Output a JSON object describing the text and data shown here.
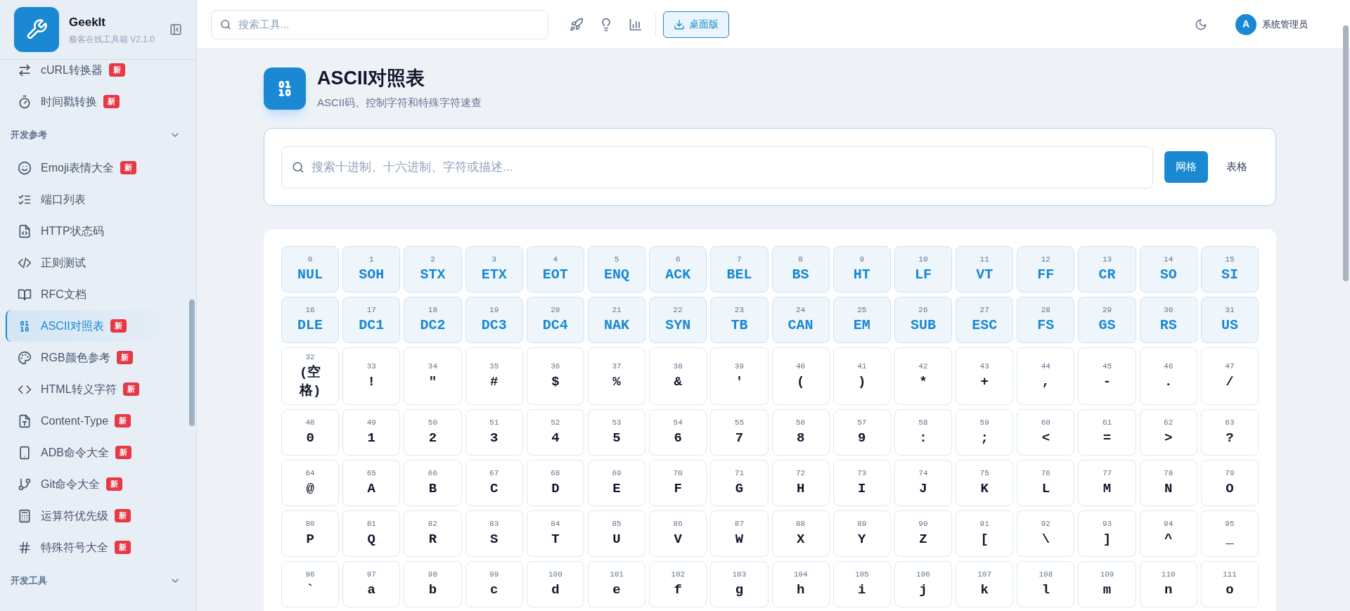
{
  "sidebar": {
    "brand": {
      "name": "GeekIt",
      "subtitle": "极客在线工具箱 V2.1.0"
    },
    "entries": [
      {
        "kind": "item",
        "label": "cURL转换器",
        "badge": "新",
        "selected": false
      },
      {
        "kind": "item",
        "label": "时间戳转换",
        "badge": "新",
        "selected": false
      },
      {
        "kind": "section",
        "label": "开发参考",
        "expanded": true
      },
      {
        "kind": "item",
        "label": "Emoji表情大全",
        "badge": "新",
        "selected": false
      },
      {
        "kind": "item",
        "label": "端口列表",
        "selected": false
      },
      {
        "kind": "item",
        "label": "HTTP状态码",
        "selected": false
      },
      {
        "kind": "item",
        "label": "正则测试",
        "selected": false
      },
      {
        "kind": "item",
        "label": "RFC文档",
        "selected": false
      },
      {
        "kind": "item",
        "label": "ASCII对照表",
        "badge": "新",
        "selected": true
      },
      {
        "kind": "item",
        "label": "RGB颜色参考",
        "badge": "新",
        "selected": false
      },
      {
        "kind": "item",
        "label": "HTML转义字符",
        "badge": "新",
        "selected": false
      },
      {
        "kind": "item",
        "label": "Content-Type",
        "badge": "新",
        "selected": false
      },
      {
        "kind": "item",
        "label": "ADB命令大全",
        "badge": "新",
        "selected": false
      },
      {
        "kind": "item",
        "label": "Git命令大全",
        "badge": "新",
        "selected": false
      },
      {
        "kind": "item",
        "label": "运算符优先级",
        "badge": "新",
        "selected": false
      },
      {
        "kind": "item",
        "label": "特殊符号大全",
        "badge": "新",
        "selected": false
      },
      {
        "kind": "section",
        "label": "开发工具",
        "expanded": true
      }
    ]
  },
  "header": {
    "search": {
      "placeholder": "搜索工具..."
    },
    "desktop_button": "桌面版",
    "user": {
      "avatar": "A",
      "name": "系统管理员"
    }
  },
  "page": {
    "title": "ASCII对照表",
    "subtitle": "ASCII码、控制字符和特殊字符速查"
  },
  "filter": {
    "search": {
      "placeholder": "搜索十进制、十六进制、字符或描述..."
    },
    "views": [
      {
        "label": "网格",
        "selected": true
      },
      {
        "label": "表格",
        "selected": false
      }
    ]
  },
  "cells": [
    {
      "code": "0",
      "char": "NUL",
      "kind": "control"
    },
    {
      "code": "1",
      "char": "SOH",
      "kind": "control"
    },
    {
      "code": "2",
      "char": "STX",
      "kind": "control"
    },
    {
      "code": "3",
      "char": "ETX",
      "kind": "control"
    },
    {
      "code": "4",
      "char": "EOT",
      "kind": "control"
    },
    {
      "code": "5",
      "char": "ENQ",
      "kind": "control"
    },
    {
      "code": "6",
      "char": "ACK",
      "kind": "control"
    },
    {
      "code": "7",
      "char": "BEL",
      "kind": "control"
    },
    {
      "code": "8",
      "char": "BS",
      "kind": "control"
    },
    {
      "code": "9",
      "char": "HT",
      "kind": "control"
    },
    {
      "code": "10",
      "char": "LF",
      "kind": "control"
    },
    {
      "code": "11",
      "char": "VT",
      "kind": "control"
    },
    {
      "code": "12",
      "char": "FF",
      "kind": "control"
    },
    {
      "code": "13",
      "char": "CR",
      "kind": "control"
    },
    {
      "code": "14",
      "char": "SO",
      "kind": "control"
    },
    {
      "code": "15",
      "char": "SI",
      "kind": "control"
    },
    {
      "code": "16",
      "char": "DLE",
      "kind": "control"
    },
    {
      "code": "17",
      "char": "DC1",
      "kind": "control"
    },
    {
      "code": "18",
      "char": "DC2",
      "kind": "control"
    },
    {
      "code": "19",
      "char": "DC3",
      "kind": "control"
    },
    {
      "code": "20",
      "char": "DC4",
      "kind": "control"
    },
    {
      "code": "21",
      "char": "NAK",
      "kind": "control"
    },
    {
      "code": "22",
      "char": "SYN",
      "kind": "control"
    },
    {
      "code": "23",
      "char": "TB",
      "kind": "control"
    },
    {
      "code": "24",
      "char": "CAN",
      "kind": "control"
    },
    {
      "code": "25",
      "char": "EM",
      "kind": "control"
    },
    {
      "code": "26",
      "char": "SUB",
      "kind": "control"
    },
    {
      "code": "27",
      "char": "ESC",
      "kind": "control"
    },
    {
      "code": "28",
      "char": "FS",
      "kind": "control"
    },
    {
      "code": "29",
      "char": "GS",
      "kind": "control"
    },
    {
      "code": "30",
      "char": "RS",
      "kind": "control"
    },
    {
      "code": "31",
      "char": "US",
      "kind": "control"
    },
    {
      "code": "32",
      "char": "(空格)",
      "kind": "printable"
    },
    {
      "code": "33",
      "char": "!",
      "kind": "printable"
    },
    {
      "code": "34",
      "char": "\"",
      "kind": "printable"
    },
    {
      "code": "35",
      "char": "#",
      "kind": "printable"
    },
    {
      "code": "36",
      "char": "$",
      "kind": "printable"
    },
    {
      "code": "37",
      "char": "%",
      "kind": "printable"
    },
    {
      "code": "38",
      "char": "&",
      "kind": "printable"
    },
    {
      "code": "39",
      "char": "'",
      "kind": "printable"
    },
    {
      "code": "40",
      "char": "(",
      "kind": "printable"
    },
    {
      "code": "41",
      "char": ")",
      "kind": "printable"
    },
    {
      "code": "42",
      "char": "*",
      "kind": "printable"
    },
    {
      "code": "43",
      "char": "+",
      "kind": "printable"
    },
    {
      "code": "44",
      "char": ",",
      "kind": "printable"
    },
    {
      "code": "45",
      "char": "-",
      "kind": "printable"
    },
    {
      "code": "46",
      "char": ".",
      "kind": "printable"
    },
    {
      "code": "47",
      "char": "/",
      "kind": "printable"
    },
    {
      "code": "48",
      "char": "0",
      "kind": "printable"
    },
    {
      "code": "49",
      "char": "1",
      "kind": "printable"
    },
    {
      "code": "50",
      "char": "2",
      "kind": "printable"
    },
    {
      "code": "51",
      "char": "3",
      "kind": "printable"
    },
    {
      "code": "52",
      "char": "4",
      "kind": "printable"
    },
    {
      "code": "53",
      "char": "5",
      "kind": "printable"
    },
    {
      "code": "54",
      "char": "6",
      "kind": "printable"
    },
    {
      "code": "55",
      "char": "7",
      "kind": "printable"
    },
    {
      "code": "56",
      "char": "8",
      "kind": "printable"
    },
    {
      "code": "57",
      "char": "9",
      "kind": "printable"
    },
    {
      "code": "58",
      "char": ":",
      "kind": "printable"
    },
    {
      "code": "59",
      "char": ";",
      "kind": "printable"
    },
    {
      "code": "60",
      "char": "<",
      "kind": "printable"
    },
    {
      "code": "61",
      "char": "=",
      "kind": "printable"
    },
    {
      "code": "62",
      "char": ">",
      "kind": "printable"
    },
    {
      "code": "63",
      "char": "?",
      "kind": "printable"
    },
    {
      "code": "64",
      "char": "@",
      "kind": "printable"
    },
    {
      "code": "65",
      "char": "A",
      "kind": "printable"
    },
    {
      "code": "66",
      "char": "B",
      "kind": "printable"
    },
    {
      "code": "67",
      "char": "C",
      "kind": "printable"
    },
    {
      "code": "68",
      "char": "D",
      "kind": "printable"
    },
    {
      "code": "69",
      "char": "E",
      "kind": "printable"
    },
    {
      "code": "70",
      "char": "F",
      "kind": "printable"
    },
    {
      "code": "71",
      "char": "G",
      "kind": "printable"
    },
    {
      "code": "72",
      "char": "H",
      "kind": "printable"
    },
    {
      "code": "73",
      "char": "I",
      "kind": "printable"
    },
    {
      "code": "74",
      "char": "J",
      "kind": "printable"
    },
    {
      "code": "75",
      "char": "K",
      "kind": "printable"
    },
    {
      "code": "76",
      "char": "L",
      "kind": "printable"
    },
    {
      "code": "77",
      "char": "M",
      "kind": "printable"
    },
    {
      "code": "78",
      "char": "N",
      "kind": "printable"
    },
    {
      "code": "79",
      "char": "O",
      "kind": "printable"
    },
    {
      "code": "80",
      "char": "P",
      "kind": "printable"
    },
    {
      "code": "81",
      "char": "Q",
      "kind": "printable"
    },
    {
      "code": "82",
      "char": "R",
      "kind": "printable"
    },
    {
      "code": "83",
      "char": "S",
      "kind": "printable"
    },
    {
      "code": "84",
      "char": "T",
      "kind": "printable"
    },
    {
      "code": "85",
      "char": "U",
      "kind": "printable"
    },
    {
      "code": "86",
      "char": "V",
      "kind": "printable"
    },
    {
      "code": "87",
      "char": "W",
      "kind": "printable"
    },
    {
      "code": "88",
      "char": "X",
      "kind": "printable"
    },
    {
      "code": "89",
      "char": "Y",
      "kind": "printable"
    },
    {
      "code": "90",
      "char": "Z",
      "kind": "printable"
    },
    {
      "code": "91",
      "char": "[",
      "kind": "printable"
    },
    {
      "code": "92",
      "char": "\\",
      "kind": "printable"
    },
    {
      "code": "93",
      "char": "]",
      "kind": "printable"
    },
    {
      "code": "94",
      "char": "^",
      "kind": "printable"
    },
    {
      "code": "95",
      "char": "_",
      "kind": "printable"
    },
    {
      "code": "96",
      "char": "`",
      "kind": "printable"
    },
    {
      "code": "97",
      "char": "a",
      "kind": "printable"
    },
    {
      "code": "98",
      "char": "b",
      "kind": "printable"
    },
    {
      "code": "99",
      "char": "c",
      "kind": "printable"
    },
    {
      "code": "100",
      "char": "d",
      "kind": "printable"
    },
    {
      "code": "101",
      "char": "e",
      "kind": "printable"
    },
    {
      "code": "102",
      "char": "f",
      "kind": "printable"
    },
    {
      "code": "103",
      "char": "g",
      "kind": "printable"
    },
    {
      "code": "104",
      "char": "h",
      "kind": "printable"
    },
    {
      "code": "105",
      "char": "i",
      "kind": "printable"
    },
    {
      "code": "106",
      "char": "j",
      "kind": "printable"
    },
    {
      "code": "107",
      "char": "k",
      "kind": "printable"
    },
    {
      "code": "108",
      "char": "l",
      "kind": "printable"
    },
    {
      "code": "109",
      "char": "m",
      "kind": "printable"
    },
    {
      "code": "110",
      "char": "n",
      "kind": "printable"
    },
    {
      "code": "111",
      "char": "o",
      "kind": "printable"
    }
  ]
}
